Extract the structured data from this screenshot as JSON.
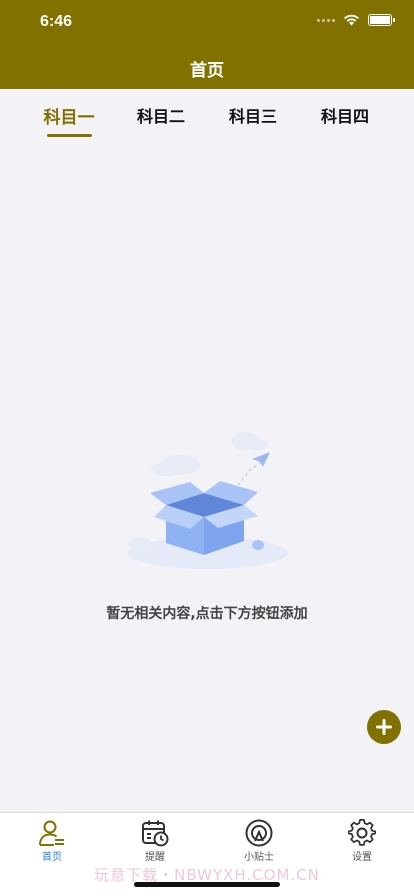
{
  "status": {
    "time": "6:46"
  },
  "header": {
    "title": "首页"
  },
  "tabs": [
    {
      "label": "科目一",
      "active": true
    },
    {
      "label": "科目二",
      "active": false
    },
    {
      "label": "科目三",
      "active": false
    },
    {
      "label": "科目四",
      "active": false
    }
  ],
  "empty": {
    "message": "暂无相关内容,点击下方按钮添加"
  },
  "fab": {
    "icon": "plus-icon"
  },
  "tabbar": [
    {
      "label": "首页",
      "icon": "user-list-icon",
      "active": true
    },
    {
      "label": "提醒",
      "icon": "calendar-clock-icon",
      "active": false
    },
    {
      "label": "小贴士",
      "icon": "tip-icon",
      "active": false
    },
    {
      "label": "设置",
      "icon": "gear-icon",
      "active": false
    }
  ],
  "watermark": "玩意下载・NBWYXH.COM.CN",
  "colors": {
    "brand": "#807100",
    "activeTabLabel": "#2a7bd6",
    "background": "#f2f2f7"
  }
}
